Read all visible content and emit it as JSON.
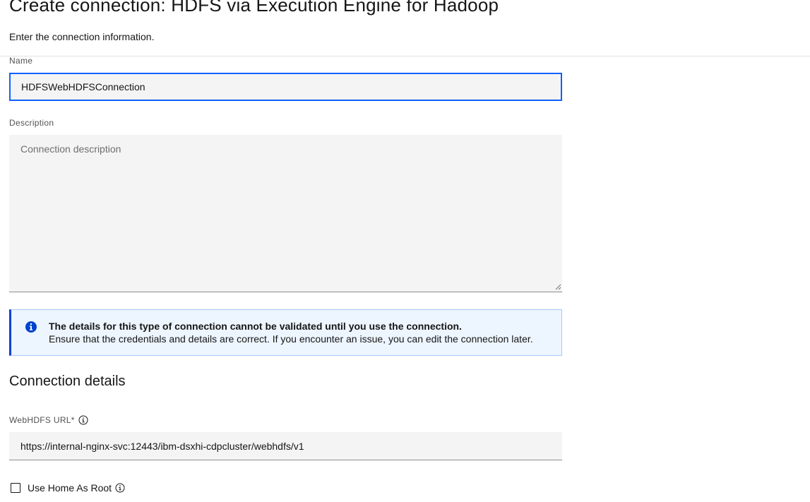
{
  "header": {
    "title": "Create connection: HDFS via Execution Engine for Hadoop",
    "subtitle": "Enter the connection information."
  },
  "form": {
    "name": {
      "label": "Name",
      "value": "HDFSWebHDFSConnection"
    },
    "description": {
      "label": "Description",
      "placeholder": "Connection description",
      "value": ""
    },
    "notification": {
      "title": "The details for this type of connection cannot be validated until you use the connection.",
      "body": "Ensure that the credentials and details are correct. If you encounter an issue, you can edit the connection later.",
      "icon": "info-filled-icon",
      "accent_color": "#0043ce"
    },
    "connection_details": {
      "heading": "Connection details",
      "webhdfs_url": {
        "label": "WebHDFS URL*",
        "value": "https://internal-nginx-svc:12443/ibm-dsxhi-cdpcluster/webhdfs/v1",
        "icon": "info-icon"
      },
      "use_home_as_root": {
        "label": "Use Home As Root",
        "checked": false,
        "icon": "info-icon"
      }
    }
  },
  "colors": {
    "focus": "#0f62fe",
    "field_background": "#f4f4f4",
    "notification_background": "#edf5ff"
  }
}
